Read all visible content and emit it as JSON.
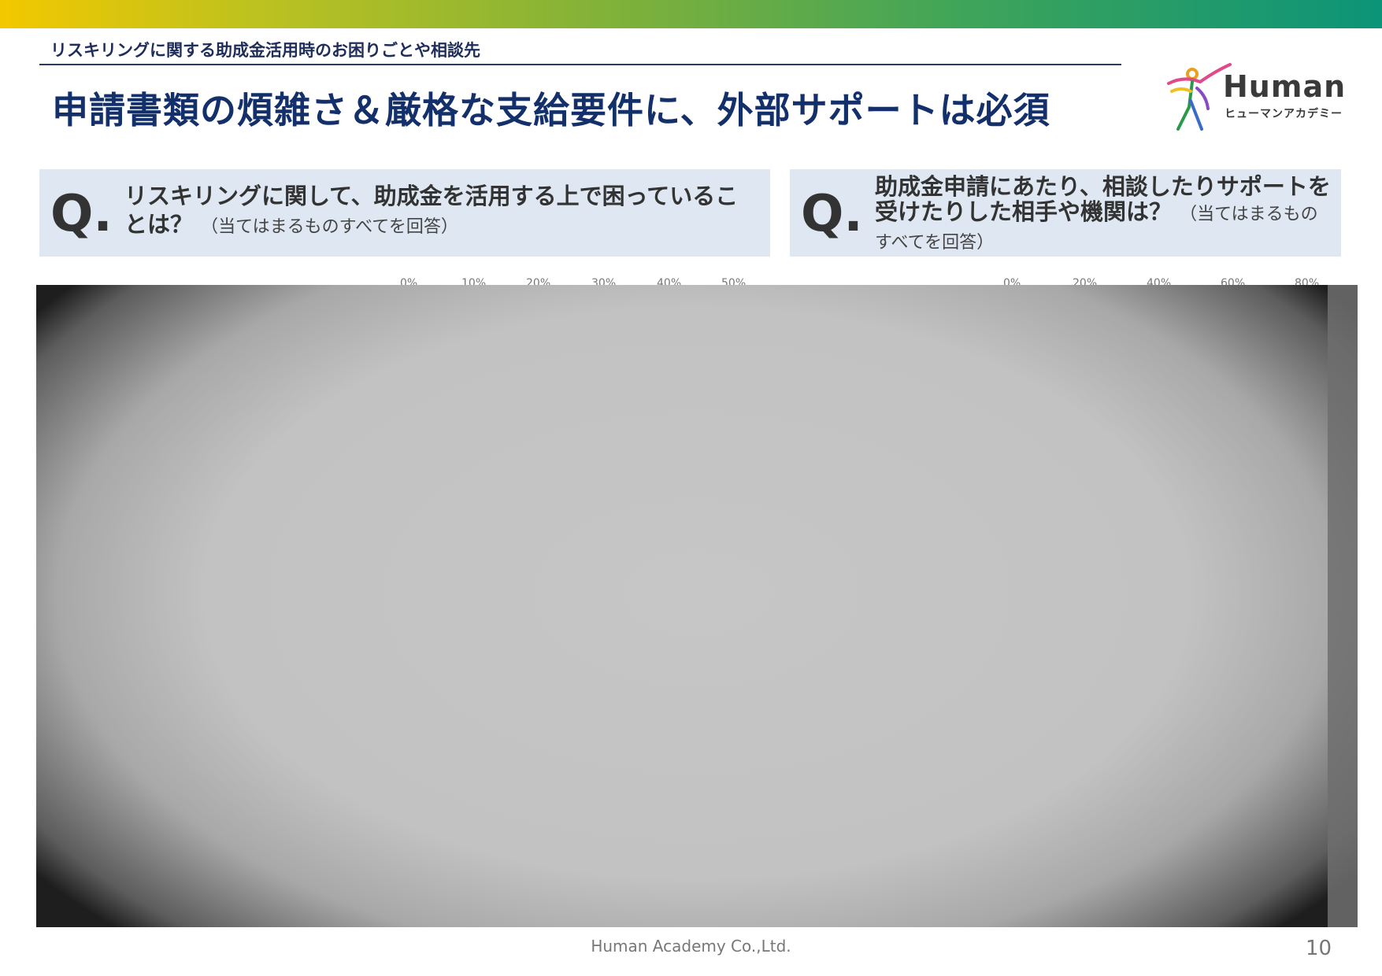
{
  "header": {
    "subtitle": "リスキリングに関する助成金活用時のお困りごとや相談先",
    "headline": "申請書類の煩雑さ＆厳格な支給要件に、外部サポートは必須"
  },
  "logo": {
    "word": "Human",
    "sub": "ヒューマンアカデミー"
  },
  "questions": [
    {
      "mark": "Q.",
      "text": "リスキリングに関して、助成金を活用する上で困っていることは？",
      "note": "（当てはまるものすべてを回答）"
    },
    {
      "mark": "Q.",
      "text": "助成金申請にあたり、相談したりサポートを受けたりした相手や機関は？",
      "note": "（当てはまるものすべてを回答）"
    }
  ],
  "left_axis_ticks": [
    "0%",
    "10%",
    "20%",
    "30%",
    "40%",
    "50%"
  ],
  "right_axis_ticks": [
    "0%",
    "20%",
    "40%",
    "60%",
    "80%"
  ],
  "footer": {
    "company": "Human Academy Co.,Ltd.",
    "page": "10"
  },
  "colors": {
    "title": "#13306b",
    "qbox": "#dfe8f2",
    "gradient_start": "#f3c800",
    "gradient_end": "#0c9478"
  }
}
